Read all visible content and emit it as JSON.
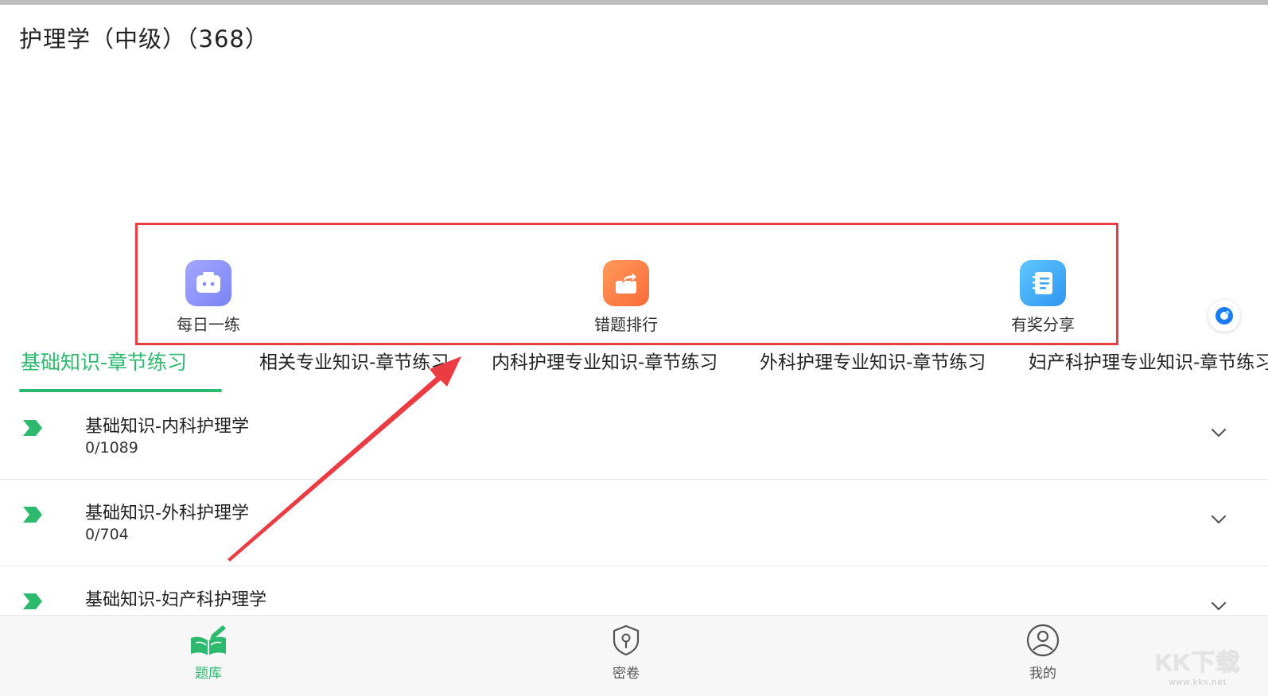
{
  "header": {
    "title": "护理学（中级）（368）"
  },
  "shortcuts": [
    {
      "label": "每日一练",
      "icon": "robot-face-icon",
      "color": "#8a90f7"
    },
    {
      "label": "错题排行",
      "icon": "export-folder-icon",
      "color": "#fc7c45"
    },
    {
      "label": "有奖分享",
      "icon": "notebook-icon",
      "color": "#3aa5f5"
    }
  ],
  "tabs": [
    {
      "label": "基础知识-章节练习",
      "active": true
    },
    {
      "label": "相关专业知识-章节练习",
      "active": false
    },
    {
      "label": "内科护理专业知识-章节练习",
      "active": false
    },
    {
      "label": "外科护理专业知识-章节练习",
      "active": false
    },
    {
      "label": "妇产科护理专业知识-章节练习",
      "active": false
    }
  ],
  "chapters": [
    {
      "name": "基础知识-内科护理学",
      "progress": "0/1089"
    },
    {
      "name": "基础知识-外科护理学",
      "progress": "0/704"
    },
    {
      "name": "基础知识-妇产科护理学",
      "progress": ""
    }
  ],
  "bottom_nav": [
    {
      "label": "题库",
      "icon": "book-pen-icon",
      "active": true
    },
    {
      "label": "密卷",
      "icon": "shield-lock-icon",
      "active": false
    },
    {
      "label": "我的",
      "icon": "user-icon",
      "active": false
    }
  ],
  "watermark": {
    "logo": "KK下载",
    "url": "www.kkx.net"
  },
  "colors": {
    "accent": "#2db96e",
    "highlight": "#ea3c42"
  }
}
